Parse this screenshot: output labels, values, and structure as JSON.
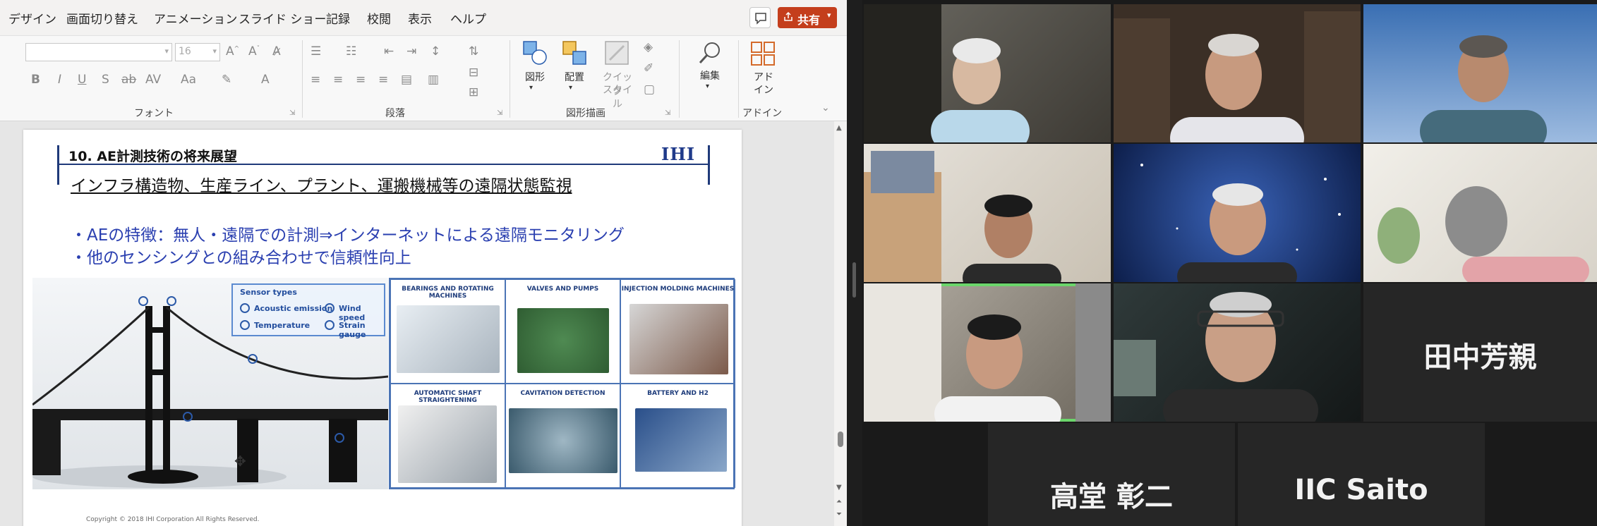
{
  "menu": {
    "items": [
      "デザイン",
      "画面切り替え",
      "アニメーション",
      "スライド ショー",
      "記録",
      "校閲",
      "表示",
      "ヘルプ"
    ],
    "share_label": "共有"
  },
  "ribbon": {
    "font_size_value": "16",
    "groups": {
      "font": "フォント",
      "paragraph": "段落",
      "drawing": "図形描画",
      "addin": "アドイン"
    },
    "buttons": {
      "shapes": "図形",
      "arrange": "配置",
      "quick_styles_1": "クイック",
      "quick_styles_2": "スタイル",
      "edit": "編集",
      "addin_1": "アド",
      "addin_2": "イン"
    }
  },
  "slide": {
    "heading": "10. AE計測技術の将来展望",
    "logo": "IHI",
    "subtitle": "インフラ構造物、生産ライン、プラント、運搬機械等の遠隔状態監視",
    "bullets": [
      "・AEの特徴：無人・遠隔での計測⇒インターネットによる遠隔モニタリング",
      "・他のセンシングとの組み合わせで信頼性向上"
    ],
    "legend": {
      "title": "Sensor types",
      "acoustic": "Acoustic emission",
      "wind": "Wind speed",
      "temperature": "Temperature",
      "strain": "Strain gauge"
    },
    "cells": [
      "BEARINGS AND ROTATING MACHINES",
      "VALVES AND PUMPS",
      "INJECTION MOLDING MACHINES",
      "AUTOMATIC SHAFT STRAIGHTENING",
      "CAVITATION DETECTION",
      "BATTERY AND H2"
    ],
    "copyright": "Copyright © 2018 IHI Corporation All Rights Reserved."
  },
  "meeting": {
    "name_tiles": {
      "tanaka": "田中芳親",
      "takado": "高堂 彰二",
      "saito": "IIC Saito"
    }
  },
  "colors": {
    "share": "#c43e1c",
    "active_speaker": "#6bd66b",
    "slide_blue": "#2a3fb0"
  }
}
